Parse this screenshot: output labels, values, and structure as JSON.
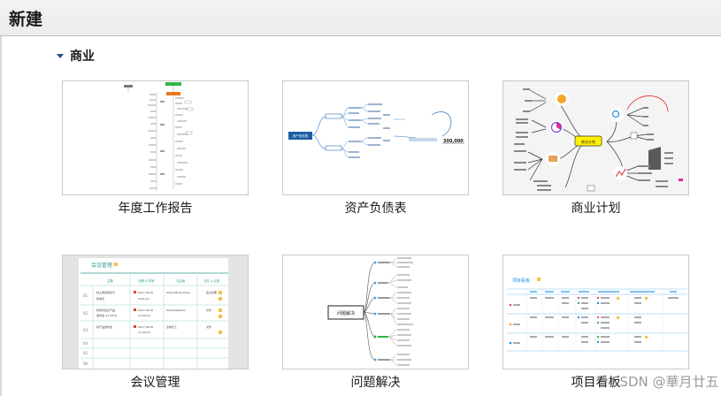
{
  "header": {
    "title": "新建"
  },
  "section": {
    "label": "商业"
  },
  "templates": [
    {
      "label": "年度工作报告"
    },
    {
      "label": "资产负债表"
    },
    {
      "label": "商业计划"
    },
    {
      "label": "会议管理"
    },
    {
      "label": "问题解决"
    },
    {
      "label": "项目看板"
    }
  ],
  "thumbnails": {
    "balance": {
      "root": "资产负债表",
      "amount": "300,000"
    },
    "business": {
      "center": "商业计划"
    },
    "meeting": {
      "title": "会议管理",
      "headers": [
        "主题",
        "日期 & 时间",
        "与会者",
        "文件 & 记录"
      ],
      "rows": [
        {
          "no": "01",
          "topic": "线上季度例会与",
          "topic2": "新成员",
          "date": "2017 09:30",
          "time": "9:00 pm",
          "who": "Owen/Molly/Olivia",
          "file": "会议纪要"
        },
        {
          "no": "02",
          "topic": "新成员会议产品",
          "topic2": "发布会 Q3 2018",
          "date": "2017 09:30",
          "time": "10:00 am",
          "who": "Owen/Stephen",
          "file": "文件"
        },
        {
          "no": "03",
          "topic": "新产品发布会",
          "topic2": "",
          "date": "2017 09:30",
          "time": "11:00 am",
          "who": "全体员工",
          "file": "文件"
        },
        {
          "no": "04"
        },
        {
          "no": "05"
        },
        {
          "no": "06"
        }
      ]
    },
    "problem": {
      "center": "问题解决"
    },
    "kanban": {
      "title": "项目看板"
    }
  },
  "watermark": "CSDN @華月廿五"
}
